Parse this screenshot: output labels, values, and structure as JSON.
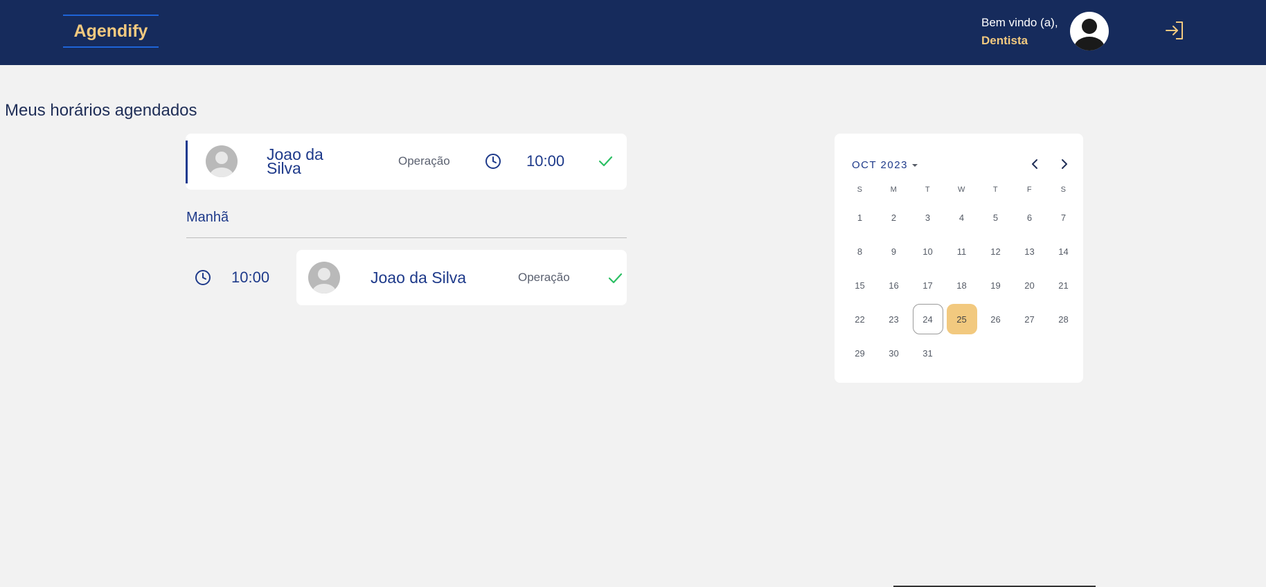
{
  "header": {
    "logo": "Agendify",
    "welcome": "Bem vindo (a),",
    "role": "Dentista"
  },
  "page": {
    "title": "Meus horários agendados"
  },
  "next_appointment": {
    "name": "Joao da Silva",
    "procedure": "Operação",
    "time": "10:00"
  },
  "schedule": {
    "section": "Manhã",
    "items": [
      {
        "time": "10:00",
        "name": "Joao da Silva",
        "procedure": "Operação"
      }
    ]
  },
  "calendar": {
    "month_label": "OCT 2023",
    "weekdays": [
      "S",
      "M",
      "T",
      "W",
      "T",
      "F",
      "S"
    ],
    "first_weekday_offset": 0,
    "days_in_month": 31,
    "today": 24,
    "selected": 25
  },
  "colors": {
    "header_bg": "#162b5c",
    "accent_gold": "#f2c97f",
    "accent_blue": "#1e3a8a",
    "check_green": "#2bbf63"
  },
  "icons": {
    "clock": "clock-icon",
    "check": "check-icon",
    "logout": "logout-icon",
    "avatar": "user-avatar-icon"
  }
}
